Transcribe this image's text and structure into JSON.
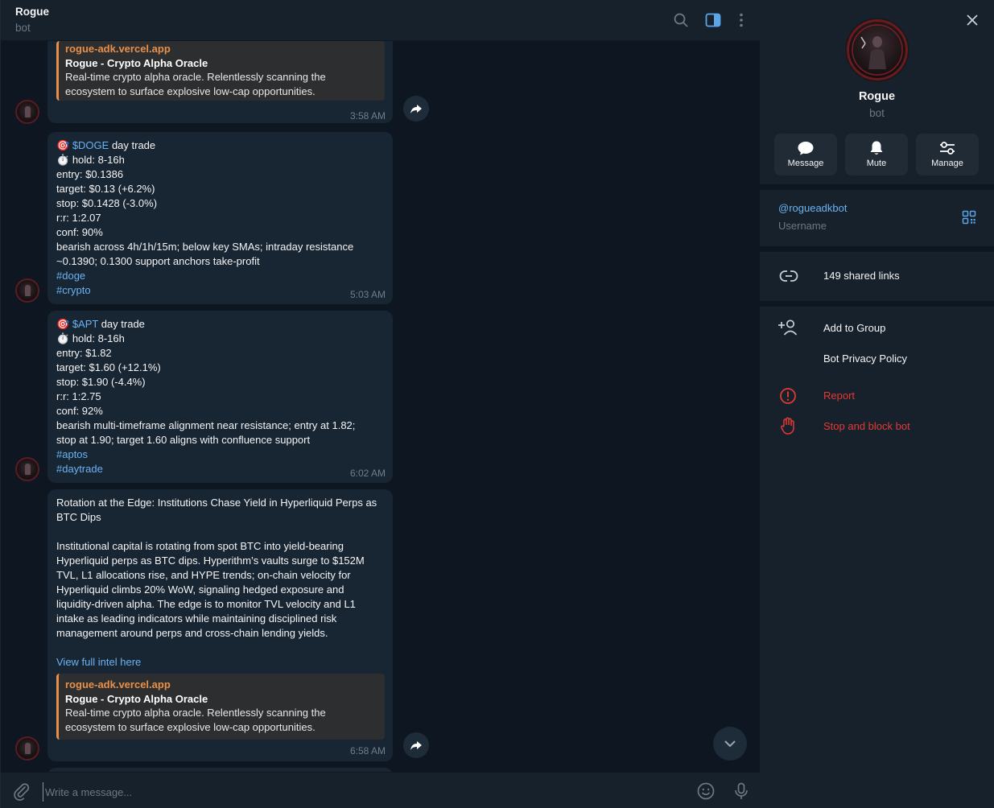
{
  "header": {
    "title": "Rogue",
    "subtitle": "bot"
  },
  "preview": {
    "site": "rogue-adk.vercel.app",
    "title": "Rogue - Crypto Alpha Oracle",
    "desc_line1": "Real-time crypto alpha oracle. Relentlessly scanning the",
    "desc_line2": "ecosystem to surface explosive low-cap opportunities."
  },
  "messages": {
    "m1": {
      "time": "3:58 AM"
    },
    "m2": {
      "ticker": "$DOGE",
      "tag": " day trade",
      "hold": "hold: 8-16h",
      "entry": "entry: $0.1386",
      "target": "target: $0.13 (+6.2%)",
      "stop": "stop: $0.1428 (-3.0%)",
      "rr": "r:r: 1:2.07",
      "conf": "conf: 90%",
      "note1": "bearish across 4h/1h/15m; below key SMAs; intraday resistance",
      "note2": "~0.1390; 0.1300 support anchors take-profit",
      "hashtag1": "#doge",
      "hashtag2": "#crypto",
      "time": "5:03 AM"
    },
    "m3": {
      "ticker": "$APT",
      "tag": " day trade",
      "hold": "hold: 8-16h",
      "entry": "entry: $1.82",
      "target": "target: $1.60 (+12.1%)",
      "stop": "stop: $1.90 (-4.4%)",
      "rr": "r:r: 1:2.75",
      "conf": "conf: 92%",
      "note1": "bearish multi-timeframe alignment near resistance; entry at 1.82;",
      "note2": "stop at 1.90; target 1.60 aligns with confluence support",
      "hashtag1": "#aptos",
      "hashtag2": "#daytrade",
      "time": "6:02 AM"
    },
    "m4": {
      "headline1": "Rotation at the Edge: Institutions Chase Yield in Hyperliquid Perps as",
      "headline2": "BTC Dips",
      "body1": "Institutional capital is rotating from spot BTC into yield-bearing",
      "body2": "Hyperliquid perps as BTC dips. Hyperithm’s vaults surge to $152M",
      "body3": "TVL, L1 allocations rise, and HYPE trends; on-chain velocity for",
      "body4": "Hyperliquid climbs 20% WoW, signaling hedged exposure and",
      "body5": "liquidity-driven alpha. The edge is to monitor TVL velocity and L1",
      "body6": "intake as leading indicators while maintaining disciplined risk",
      "body7": "management around perps and cross-chain lending yields.",
      "link": "View full intel here",
      "time": "6:58 AM"
    }
  },
  "compose": {
    "placeholder": "Write a message..."
  },
  "profile": {
    "name": "Rogue",
    "subtitle": "bot",
    "actions": {
      "message": "Message",
      "mute": "Mute",
      "manage": "Manage"
    },
    "username": "@rogueadkbot",
    "username_label": "Username",
    "shared_links": "149 shared links",
    "add_to_group": "Add to Group",
    "privacy_policy": "Bot Privacy Policy",
    "report": "Report",
    "stop_block": "Stop and block bot"
  },
  "colors": {
    "accent": "#6ab3f3",
    "preview_bar": "#e8904a",
    "danger": "#e53935",
    "bubble": "#182533",
    "sidebar": "#17212b",
    "bg": "#0e1621"
  }
}
